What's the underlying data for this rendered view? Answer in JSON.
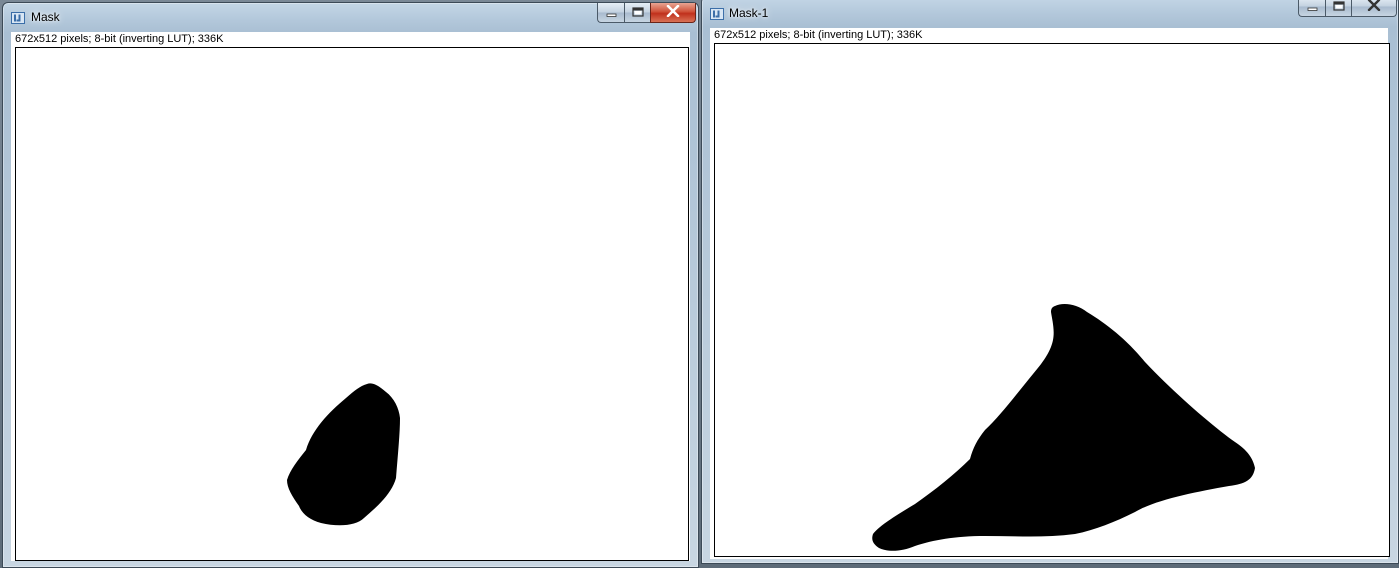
{
  "windows": [
    {
      "title": "Mask",
      "info": "672x512 pixels; 8-bit (inverting LUT); 336K",
      "app_icon": "imagej-icon",
      "buttons": {
        "minimize": "minimize-icon",
        "maximize": "maximize-icon",
        "close": "close-icon"
      }
    },
    {
      "title": "Mask-1",
      "info": "672x512 pixels; 8-bit (inverting LUT); 336K",
      "app_icon": "imagej-icon",
      "buttons": {
        "minimize": "minimize-icon",
        "maximize": "maximize-icon",
        "close": "close-icon"
      }
    }
  ],
  "colors": {
    "mask_foreground": "#000000",
    "mask_background": "#ffffff",
    "close_button": "#c9432b"
  }
}
